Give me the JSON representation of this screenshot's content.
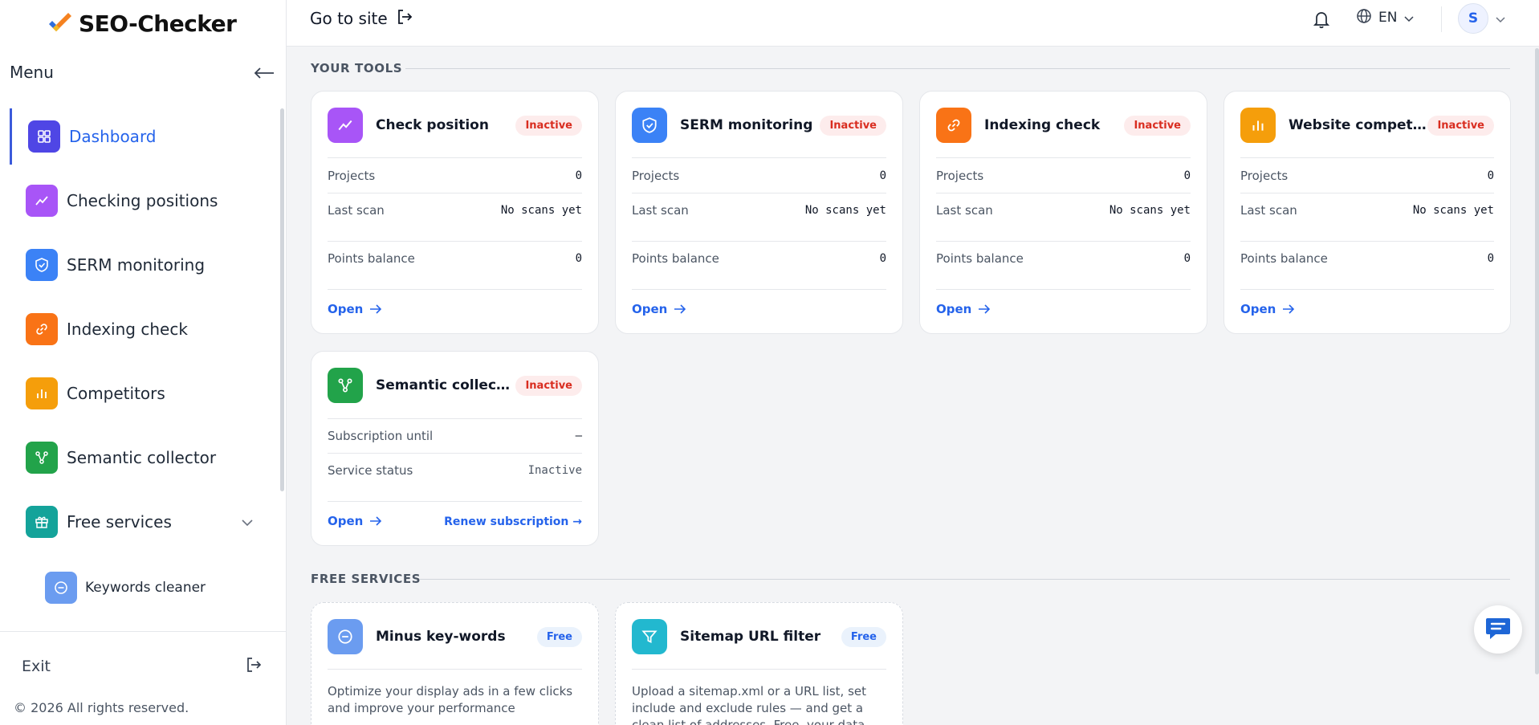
{
  "brand": {
    "name": "SEO-Checker"
  },
  "sidebar": {
    "menu_title": "Menu",
    "items": [
      {
        "label": "Dashboard",
        "icon": "dashboard-icon",
        "color": "#4f46e5"
      },
      {
        "label": "Checking positions",
        "icon": "trend-icon",
        "color": "#a855f7"
      },
      {
        "label": "SERM monitoring",
        "icon": "shield-icon",
        "color": "#3b82f6"
      },
      {
        "label": "Indexing check",
        "icon": "link-icon",
        "color": "#f97316"
      },
      {
        "label": "Competitors",
        "icon": "bar-chart-icon",
        "color": "#f59e0b"
      },
      {
        "label": "Semantic collector",
        "icon": "network-icon",
        "color": "#22a34a"
      },
      {
        "label": "Free services",
        "icon": "gift-icon",
        "color": "#14a39a"
      }
    ],
    "sub_items": [
      {
        "label": "Keywords cleaner",
        "icon": "minus-circle-icon",
        "color": "#6b9cf0"
      }
    ],
    "exit_label": "Exit",
    "copyright": "© 2026 All rights reserved."
  },
  "header": {
    "goto_label": "Go to site",
    "language": "EN",
    "user_initial": "S"
  },
  "sections": {
    "tools_title": "YOUR TOOLS",
    "free_title": "FREE SERVICES"
  },
  "tools": [
    {
      "title": "Check position",
      "status": "Inactive",
      "icon": "trend-icon",
      "color": "#a855f7",
      "rows": [
        {
          "k": "Projects",
          "v": "0"
        },
        {
          "k": "Last scan",
          "v": "No scans yet"
        },
        {
          "k": "Points balance",
          "v": "0"
        }
      ],
      "open": "Open"
    },
    {
      "title": "SERM monitoring",
      "status": "Inactive",
      "icon": "shield-icon",
      "color": "#3b82f6",
      "rows": [
        {
          "k": "Projects",
          "v": "0"
        },
        {
          "k": "Last scan",
          "v": "No scans yet"
        },
        {
          "k": "Points balance",
          "v": "0"
        }
      ],
      "open": "Open"
    },
    {
      "title": "Indexing check",
      "status": "Inactive",
      "icon": "link-icon",
      "color": "#f97316",
      "rows": [
        {
          "k": "Projects",
          "v": "0"
        },
        {
          "k": "Last scan",
          "v": "No scans yet"
        },
        {
          "k": "Points balance",
          "v": "0"
        }
      ],
      "open": "Open"
    },
    {
      "title": "Website competitors",
      "status": "Inactive",
      "icon": "bar-chart-icon",
      "color": "#f59e0b",
      "rows": [
        {
          "k": "Projects",
          "v": "0"
        },
        {
          "k": "Last scan",
          "v": "No scans yet"
        },
        {
          "k": "Points balance",
          "v": "0"
        }
      ],
      "open": "Open"
    }
  ],
  "semantic": {
    "title": "Semantic collector",
    "status": "Inactive",
    "icon": "network-icon",
    "color": "#22a34a",
    "rows": [
      {
        "k": "Subscription until",
        "v": "–"
      },
      {
        "k": "Service status",
        "v": "Inactive"
      }
    ],
    "open": "Open",
    "renew": "Renew subscription →"
  },
  "free_services": [
    {
      "title": "Minus key-words",
      "badge": "Free",
      "icon": "minus-circle-icon",
      "color": "#6b9cf0",
      "desc": "Optimize your display ads in a few clicks and improve your performance"
    },
    {
      "title": "Sitemap URL filter",
      "badge": "Free",
      "icon": "filter-icon",
      "color": "#22b8cf",
      "desc": "Upload a sitemap.xml or a URL list, set include and exclude rules — and get a clean list of addresses. Free, your data never"
    }
  ]
}
